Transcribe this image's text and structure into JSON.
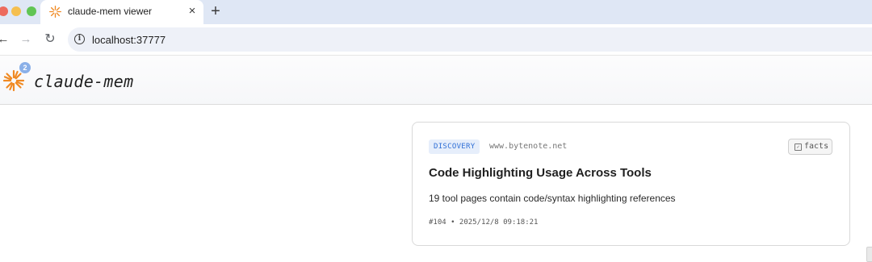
{
  "browser": {
    "tab": {
      "title": "claude-mem viewer",
      "close_glyph": "×"
    },
    "new_tab_glyph": "+",
    "nav": {
      "back_glyph": "←",
      "forward_glyph": "→",
      "reload_glyph": "↻"
    },
    "address": {
      "info_glyph": "i",
      "url": "localhost:37777"
    }
  },
  "app": {
    "name": "claude-mem",
    "logo_icon": "sunburst-logo-icon",
    "badge_count": "2",
    "accent_color": "#f08a24"
  },
  "card": {
    "type_badge": "DISCOVERY",
    "source": "www.bytenote.net",
    "facts_label": "facts",
    "facts_icon": "checkbox-icon",
    "facts_glyph": "✓",
    "title": "Code Highlighting Usage Across Tools",
    "description": "19 tool pages contain code/syntax highlighting references",
    "meta": "#104 • 2025/12/8 09:18:21"
  }
}
